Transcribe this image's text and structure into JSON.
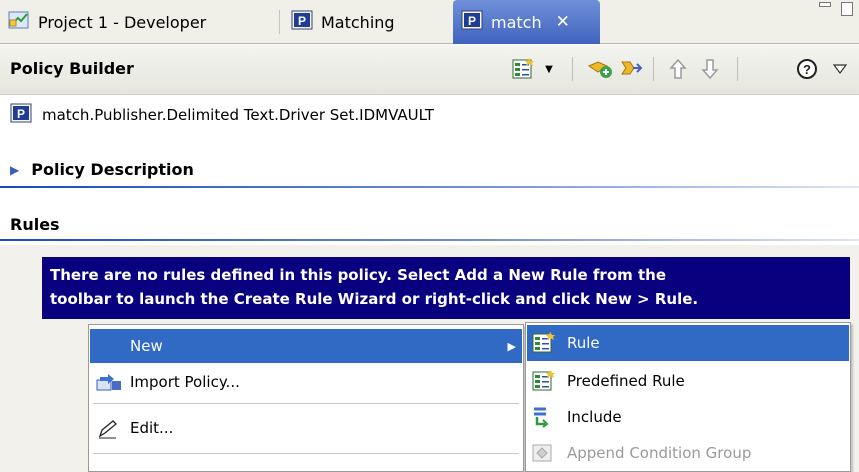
{
  "tabs": [
    {
      "label": "Project 1 - Developer",
      "icon": "project-diagram-icon"
    },
    {
      "label": "Matching",
      "icon": "policy-p-icon"
    },
    {
      "label": "match",
      "icon": "policy-p-icon",
      "active": true,
      "close": "✕"
    }
  ],
  "header": {
    "title": "Policy Builder",
    "toolbar": [
      "rule-wizard-icon",
      "dropdown-icon",
      "add-rule-icon",
      "jump-icon",
      "move-up-icon",
      "move-down-icon",
      "help-icon",
      "view-menu-icon"
    ]
  },
  "policy": {
    "path": "match.Publisher.Delimited Text.Driver Set.IDMVAULT"
  },
  "sections": {
    "description": "Policy Description",
    "rules": "Rules"
  },
  "message": {
    "line1": "There are no rules defined in this policy. Select Add a New Rule from the",
    "line2": "toolbar to launch the Create Rule Wizard or right-click and click New > Rule."
  },
  "context_menu": {
    "items": [
      {
        "label": "New",
        "selected": true,
        "has_submenu": true
      },
      {
        "label": "Import Policy..."
      },
      {
        "label": "Edit..."
      }
    ]
  },
  "submenu": {
    "items": [
      {
        "label": "Rule",
        "selected": true
      },
      {
        "label": "Predefined Rule"
      },
      {
        "label": "Include"
      },
      {
        "label": "Append Condition Group",
        "disabled": true
      }
    ]
  },
  "colors": {
    "active_tab": "#3f64bf",
    "selection": "#316ac5",
    "message_bg": "#08007f",
    "section_line": "#1f48b8"
  }
}
